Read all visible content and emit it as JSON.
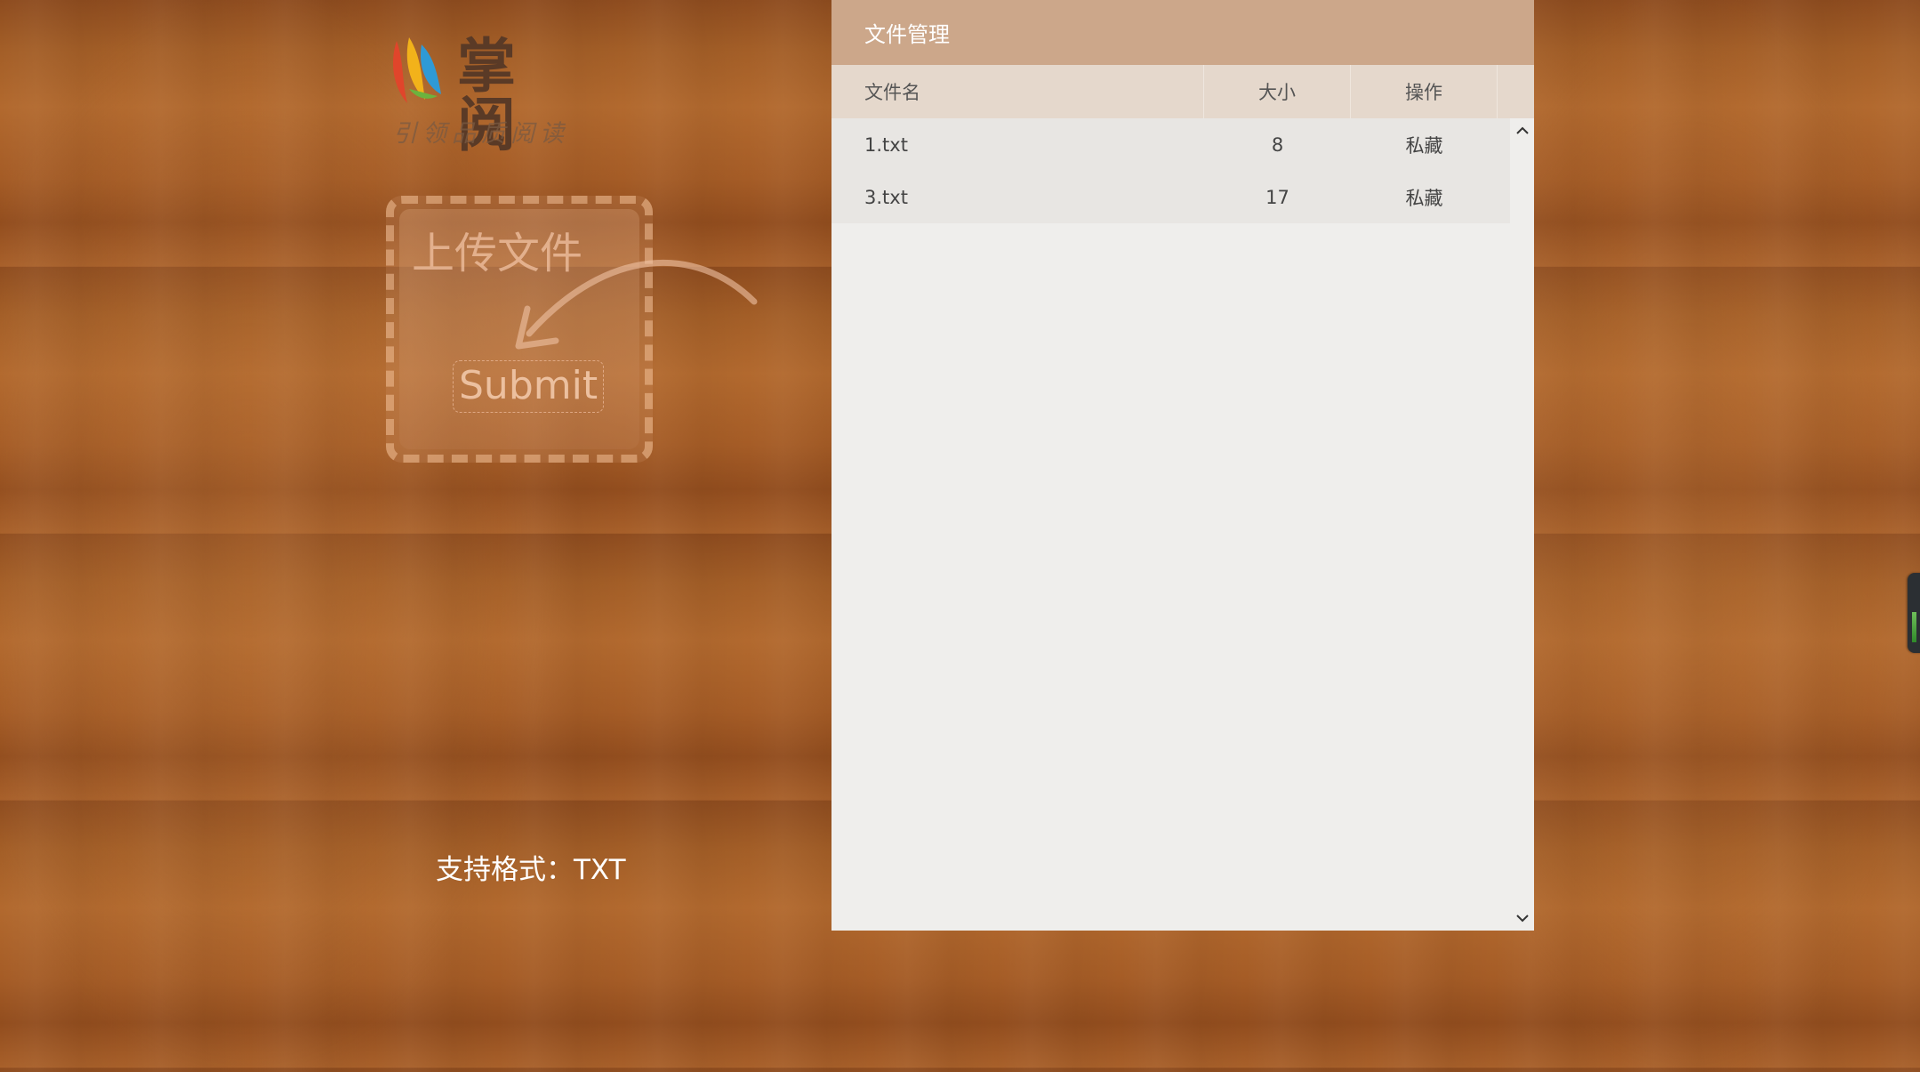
{
  "logo": {
    "name": "掌阅",
    "slogan": "引领品质阅读",
    "icon": "zhangyue-logo-icon"
  },
  "upload": {
    "title": "上传文件",
    "submit_label": "Submit",
    "arrow_icon": "curved-arrow-icon"
  },
  "formats_text": "支持格式：TXT",
  "file_manager": {
    "title": "文件管理",
    "columns": [
      "文件名",
      "大小",
      "操作"
    ],
    "rows": [
      {
        "name": "1.txt",
        "size": "8",
        "action": "私藏"
      },
      {
        "name": "3.txt",
        "size": "17",
        "action": "私藏"
      }
    ]
  },
  "colors": {
    "header": "#cca78a",
    "table_head": "#e5d8cc",
    "panel_bg": "#efeeec"
  }
}
